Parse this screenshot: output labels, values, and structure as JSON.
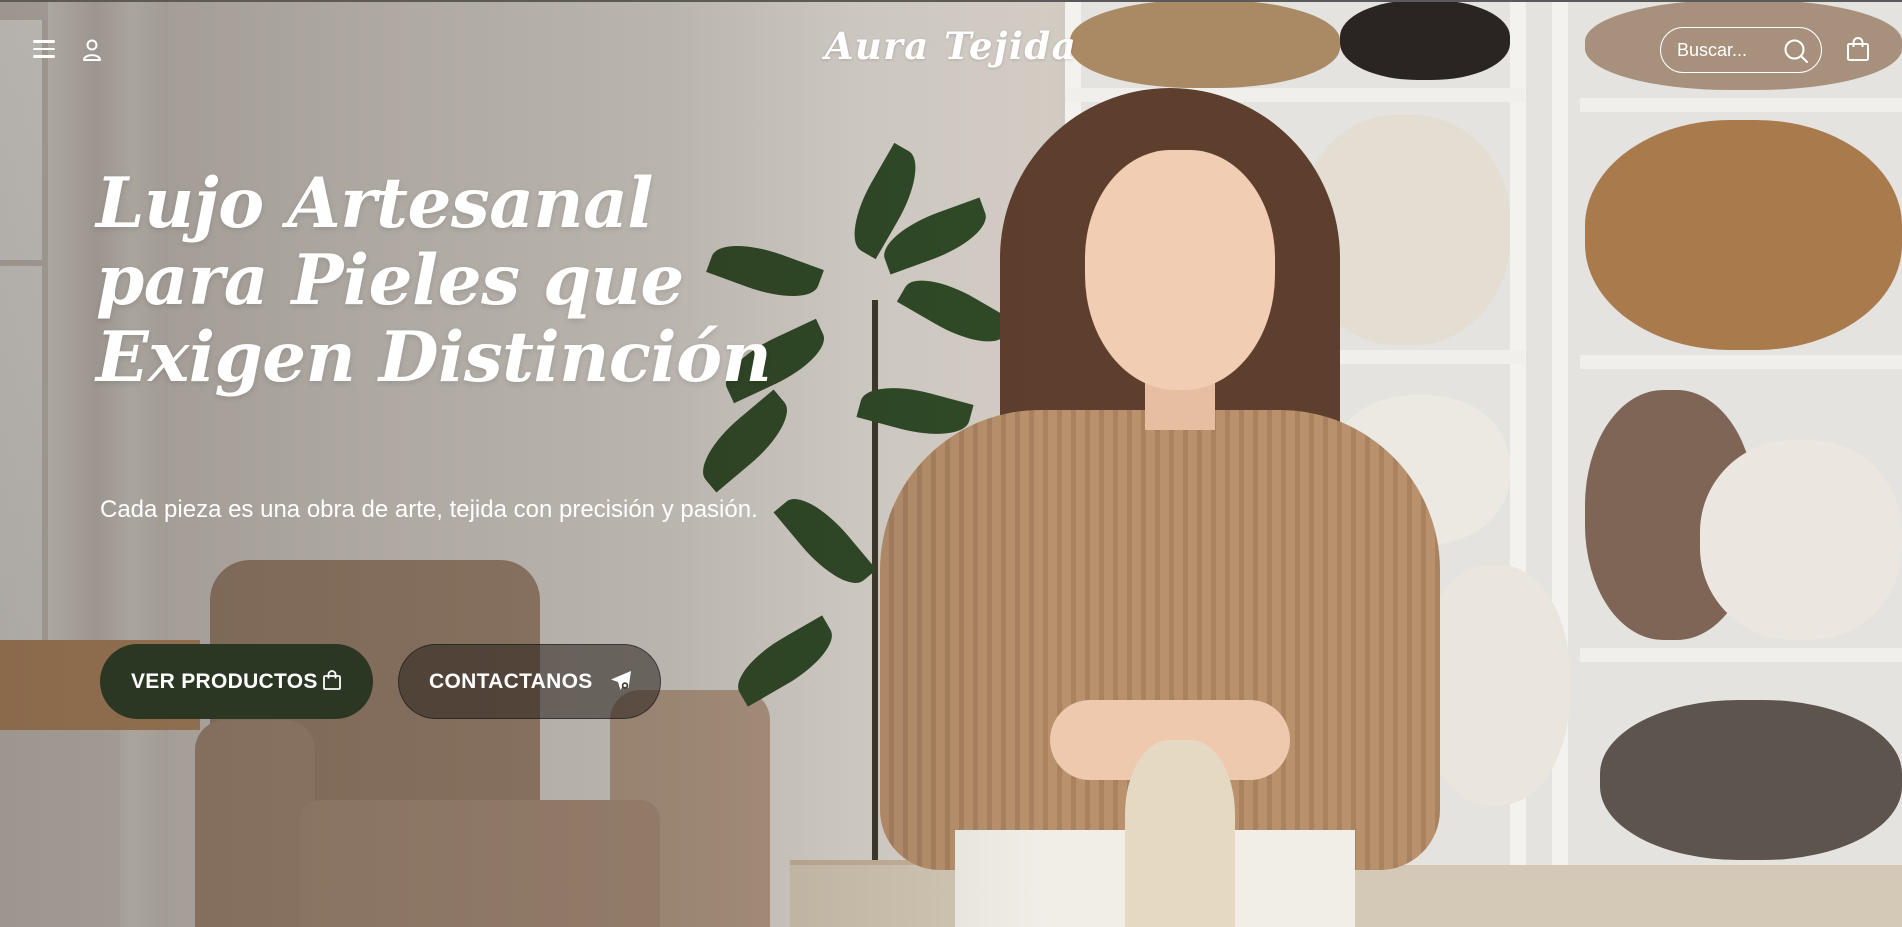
{
  "header": {
    "brand": "Aura Tejida",
    "search_placeholder": "Buscar...",
    "icons": [
      "menu-icon",
      "user-icon",
      "search-icon",
      "shopping-bag-icon"
    ]
  },
  "hero": {
    "title_lines": [
      "Lujo Artesanal",
      "para Pieles que",
      "Exigen Distinción"
    ],
    "subtitle": "Cada pieza es una obra de arte, tejida con precisión y pasión.",
    "primary_button": {
      "label": "VER PRODUCTOS",
      "icon": "shopping-bag-icon"
    },
    "secondary_button": {
      "label": "CONTACTANOS",
      "icon": "paper-plane-icon"
    }
  },
  "colors": {
    "primary_button": "#2b3723",
    "text": "#ffffff"
  }
}
